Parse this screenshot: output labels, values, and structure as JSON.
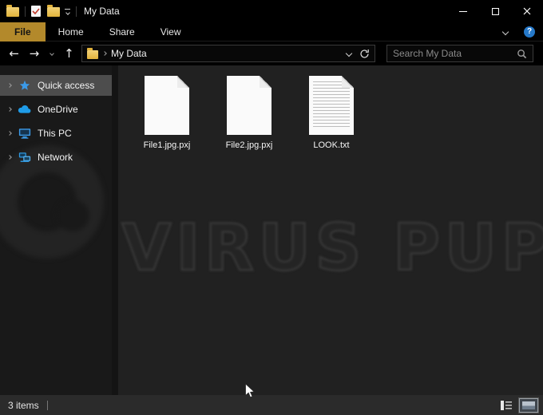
{
  "window": {
    "title": "My Data",
    "titlebar_icons": [
      "folder-icon",
      "checked-document-icon",
      "folder-icon",
      "quick-access-toolbar-dropdown-icon"
    ],
    "controls": [
      "minimize",
      "maximize",
      "close"
    ]
  },
  "ribbon": {
    "tabs": [
      {
        "label": "File",
        "active": true
      },
      {
        "label": "Home",
        "active": false
      },
      {
        "label": "Share",
        "active": false
      },
      {
        "label": "View",
        "active": false
      }
    ],
    "collapse_icon": "chevron-down-icon",
    "help_icon": "help-icon",
    "help_glyph": "?"
  },
  "toolbar": {
    "nav_icons": [
      "back-arrow-icon",
      "forward-arrow-icon",
      "recent-locations-chevron-icon",
      "up-arrow-icon"
    ],
    "back_glyph": "←",
    "forward_glyph": "→",
    "up_glyph": "↑",
    "address": {
      "location_icon": "folder-icon",
      "path": "My Data"
    },
    "address_icons": [
      "address-dropdown-chevron-icon",
      "refresh-icon"
    ],
    "search": {
      "placeholder": "Search My Data",
      "icon": "search-icon"
    }
  },
  "sidebar": {
    "items": [
      {
        "label": "Quick access",
        "icon": "star-icon",
        "selected": true
      },
      {
        "label": "OneDrive",
        "icon": "cloud-icon",
        "selected": false
      },
      {
        "label": "This PC",
        "icon": "computer-icon",
        "selected": false
      },
      {
        "label": "Network",
        "icon": "network-icon",
        "selected": false
      }
    ]
  },
  "files": [
    {
      "name": "File1.jpg.pxj",
      "icon": "blank-file-icon"
    },
    {
      "name": "File2.jpg.pxj",
      "icon": "blank-file-icon"
    },
    {
      "name": "LOOK.txt",
      "icon": "text-file-icon"
    }
  ],
  "watermark": {
    "text": "VIRUS PUP",
    "logo": "virus-pup-logo"
  },
  "statusbar": {
    "items_count": "3 items",
    "view_toggles": [
      "details-view-icon",
      "large-icons-view-icon"
    ],
    "active_view": "large-icons-view"
  },
  "cursor_icon": "arrow-cursor",
  "colors": {
    "accent_gold": "#b3892b",
    "folder_yellow": "#e8c35a",
    "icon_blue": "#2f9ae3",
    "selection_gray": "#4d4d4d",
    "content_bg": "#212121",
    "sidebar_bg": "#191919",
    "statusbar_bg": "#2b2b2b",
    "watermark_color": "#373737"
  }
}
